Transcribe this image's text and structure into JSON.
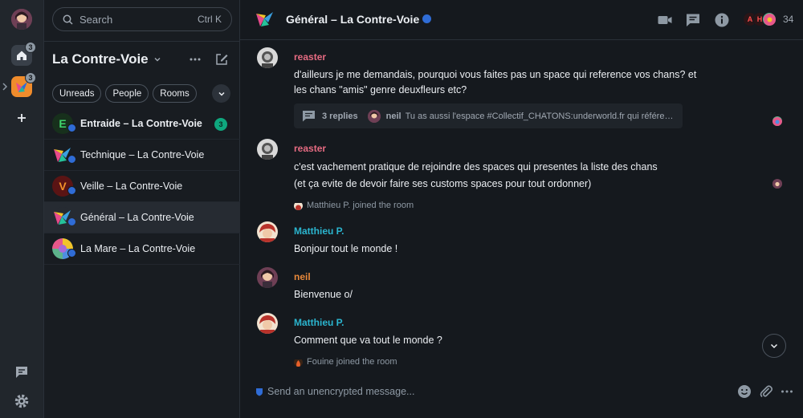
{
  "spacebar": {
    "home_badge": "3",
    "space_badge": "3"
  },
  "roomlist": {
    "search_placeholder": "Search",
    "search_shortcut": "Ctrl K",
    "space_title": "La Contre-Voie",
    "filters": [
      "Unreads",
      "People",
      "Rooms"
    ],
    "rooms": [
      {
        "name": "Entraide – La Contre-Voie",
        "avatar_letter": "E",
        "avatar_color": "#1b3a1f",
        "letter_color": "#3fd46b",
        "bold": true,
        "badge": "3"
      },
      {
        "name": "Technique – La Contre-Voie",
        "avatar_letter": "",
        "avatar_color": "#181c21",
        "bold": false,
        "badge": ""
      },
      {
        "name": "Veille – La Contre-Voie",
        "avatar_letter": "V",
        "avatar_color": "#5a1414",
        "letter_color": "#f2932a",
        "bold": false,
        "badge": ""
      },
      {
        "name": "Général – La Contre-Voie",
        "avatar_letter": "",
        "avatar_color": "#181c21",
        "bold": false,
        "badge": "",
        "selected": true
      },
      {
        "name": "La Mare – La Contre-Voie",
        "avatar_letter": "",
        "avatar_color": "#6b9",
        "bold": false,
        "badge": ""
      }
    ]
  },
  "header": {
    "title": "Général – La Contre-Voie",
    "avatars": [
      "A",
      "H"
    ],
    "member_count": "34"
  },
  "timeline": {
    "msg1": {
      "sender": "reaster",
      "lines": [
        "d'ailleurs je me demandais, pourquoi vous faites pas un space qui reference vos chans? et",
        "les chans \"amis\" genre deuxfleurs etc?"
      ],
      "thread": {
        "count": "3 replies",
        "sender": "neil",
        "preview": "Tu as aussi l'espace #Collectif_CHATONS:underworld.fr qui référen…"
      }
    },
    "msg2": {
      "sender": "reaster",
      "lines": [
        "c'est vachement pratique de rejoindre des spaces qui presentes la liste des chans",
        "(et ça evite de devoir faire ses customs spaces pour tout ordonner)"
      ]
    },
    "event1": "Matthieu P. joined the room",
    "msg3": {
      "sender": "Matthieu P.",
      "text": "Bonjour tout le monde !"
    },
    "msg4": {
      "sender": "neil",
      "text": "Bienvenue o/"
    },
    "msg5": {
      "sender": "Matthieu P.",
      "text": "Comment que va tout le monde ?"
    },
    "event2": "Fouine joined the room"
  },
  "composer": {
    "placeholder": "Send an unencrypted message..."
  },
  "colors": {
    "reaster": "#e66b82",
    "matthieu": "#2bb5cf",
    "neil": "#e8883a",
    "accent_green": "#0fa77e"
  }
}
